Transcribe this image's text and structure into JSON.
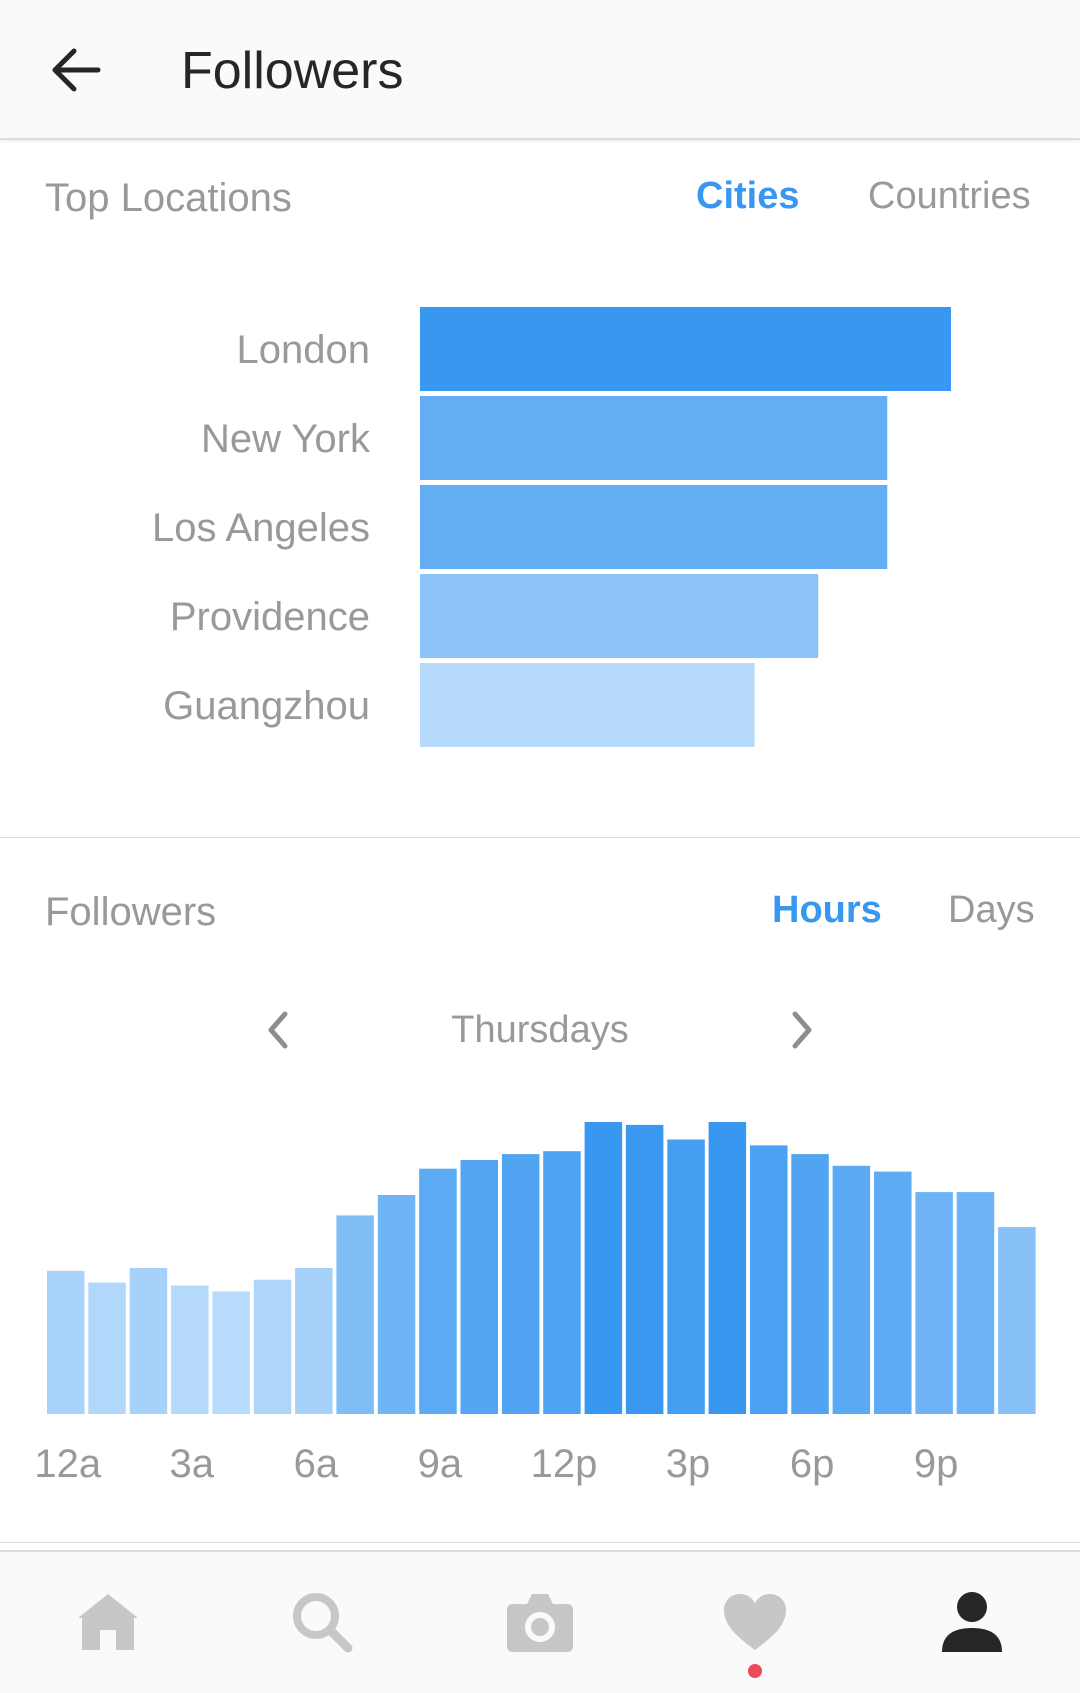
{
  "appbar": {
    "title": "Followers"
  },
  "locations": {
    "title": "Top Locations",
    "tabs": [
      {
        "label": "Cities",
        "active": true
      },
      {
        "label": "Countries",
        "active": false
      }
    ]
  },
  "followers": {
    "title": "Followers",
    "tabs": [
      {
        "label": "Hours",
        "active": true
      },
      {
        "label": "Days",
        "active": false
      }
    ],
    "day": "Thursdays"
  },
  "chart_data": [
    {
      "type": "bar",
      "orientation": "horizontal",
      "categories": [
        "London",
        "New York",
        "Los Angeles",
        "Providence",
        "Guangzhou"
      ],
      "values": [
        100,
        88,
        88,
        75,
        63
      ],
      "colors": [
        "#3897f0",
        "#62adf3",
        "#62adf3",
        "#8cc4f7",
        "#b6dafb"
      ],
      "title": "",
      "xlabel": "",
      "ylabel": ""
    },
    {
      "type": "bar",
      "categories": [
        "12a",
        "1a",
        "2a",
        "3a",
        "4a",
        "5a",
        "6a",
        "7a",
        "8a",
        "9a",
        "10a",
        "11a",
        "12p",
        "1p",
        "2p",
        "3p",
        "4p",
        "5p",
        "6p",
        "7p",
        "8p",
        "9p",
        "10p",
        "11p"
      ],
      "values": [
        49,
        45,
        50,
        44,
        42,
        46,
        50,
        68,
        75,
        84,
        87,
        89,
        90,
        100,
        99,
        94,
        100,
        92,
        89,
        85,
        83,
        76,
        76,
        64
      ],
      "tick_labels": [
        "12a",
        "3a",
        "6a",
        "9a",
        "12p",
        "3p",
        "6p",
        "9p"
      ],
      "title": "",
      "xlabel": "",
      "ylabel": "",
      "ylim": [
        0,
        100
      ]
    }
  ],
  "bottomnav": {
    "items": [
      "home-icon",
      "search-icon",
      "camera-icon",
      "heart-icon",
      "profile-icon"
    ],
    "active": "profile-icon",
    "accent": "#ed4956"
  }
}
